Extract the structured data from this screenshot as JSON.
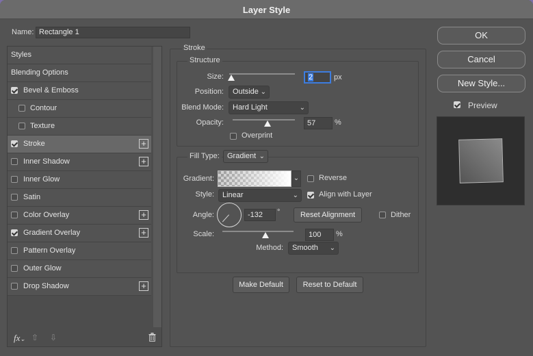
{
  "dialog": {
    "title": "Layer Style",
    "name_label": "Name:",
    "name_value": "Rectangle 1"
  },
  "styles_list": {
    "items": [
      {
        "label": "Styles",
        "checkbox": false,
        "checked": false,
        "plus": false,
        "indent": false,
        "selected": false
      },
      {
        "label": "Blending Options",
        "checkbox": false,
        "checked": false,
        "plus": false,
        "indent": false,
        "selected": false
      },
      {
        "label": "Bevel & Emboss",
        "checkbox": true,
        "checked": true,
        "plus": false,
        "indent": false,
        "selected": false
      },
      {
        "label": "Contour",
        "checkbox": true,
        "checked": false,
        "plus": false,
        "indent": true,
        "selected": false
      },
      {
        "label": "Texture",
        "checkbox": true,
        "checked": false,
        "plus": false,
        "indent": true,
        "selected": false
      },
      {
        "label": "Stroke",
        "checkbox": true,
        "checked": true,
        "plus": true,
        "indent": false,
        "selected": true
      },
      {
        "label": "Inner Shadow",
        "checkbox": true,
        "checked": false,
        "plus": true,
        "indent": false,
        "selected": false
      },
      {
        "label": "Inner Glow",
        "checkbox": true,
        "checked": false,
        "plus": false,
        "indent": false,
        "selected": false
      },
      {
        "label": "Satin",
        "checkbox": true,
        "checked": false,
        "plus": false,
        "indent": false,
        "selected": false
      },
      {
        "label": "Color Overlay",
        "checkbox": true,
        "checked": false,
        "plus": true,
        "indent": false,
        "selected": false
      },
      {
        "label": "Gradient Overlay",
        "checkbox": true,
        "checked": true,
        "plus": true,
        "indent": false,
        "selected": false
      },
      {
        "label": "Pattern Overlay",
        "checkbox": true,
        "checked": false,
        "plus": false,
        "indent": false,
        "selected": false
      },
      {
        "label": "Outer Glow",
        "checkbox": true,
        "checked": false,
        "plus": false,
        "indent": false,
        "selected": false
      },
      {
        "label": "Drop Shadow",
        "checkbox": true,
        "checked": false,
        "plus": true,
        "indent": false,
        "selected": false
      }
    ],
    "fx_label": "fx"
  },
  "stroke": {
    "section_title": "Stroke",
    "structure_title": "Structure",
    "size_label": "Size:",
    "size_value": "2",
    "size_unit": "px",
    "position_label": "Position:",
    "position_value": "Outside",
    "blend_mode_label": "Blend Mode:",
    "blend_mode_value": "Hard Light",
    "opacity_label": "Opacity:",
    "opacity_value": "57",
    "opacity_unit": "%",
    "overprint_label": "Overprint",
    "fill_type_label": "Fill Type:",
    "fill_type_value": "Gradient",
    "gradient_label": "Gradient:",
    "reverse_label": "Reverse",
    "style_label": "Style:",
    "style_value": "Linear",
    "align_label": "Align with Layer",
    "angle_label": "Angle:",
    "angle_value": "-132",
    "angle_unit": "°",
    "reset_alignment_label": "Reset Alignment",
    "dither_label": "Dither",
    "scale_label": "Scale:",
    "scale_value": "100",
    "scale_unit": "%",
    "method_label": "Method:",
    "method_value": "Smooth",
    "make_default_label": "Make Default",
    "reset_default_label": "Reset to Default"
  },
  "actions": {
    "ok_label": "OK",
    "cancel_label": "Cancel",
    "new_style_label": "New Style...",
    "preview_label": "Preview"
  }
}
